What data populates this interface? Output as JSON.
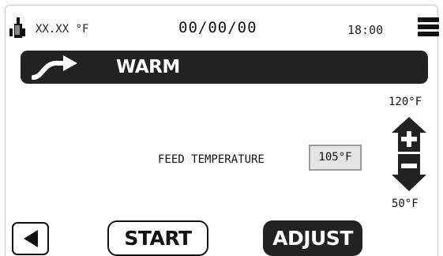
{
  "status_bar": {
    "status_icon": "bottle-icon",
    "temperature": "XX.XX °F",
    "date": "00/00/00",
    "time": "18:00",
    "menu_icon": "hamburger-menu-icon"
  },
  "mode": {
    "icon": "curved-arrow-icon",
    "label": "WARM"
  },
  "limits": {
    "max": "120°F",
    "min": "50°F"
  },
  "controls": {
    "increase_icon": "plus-arrow-up-icon",
    "decrease_icon": "minus-arrow-down-icon"
  },
  "feed": {
    "label": "FEED TEMPERATURE",
    "value": "105°F"
  },
  "buttons": {
    "back_icon": "back-triangle-icon",
    "start": "START",
    "adjust": "ADJUST"
  },
  "colors": {
    "banner": "#222222",
    "field_bg": "#e4e4e4",
    "field_border": "#9c9c9c"
  }
}
